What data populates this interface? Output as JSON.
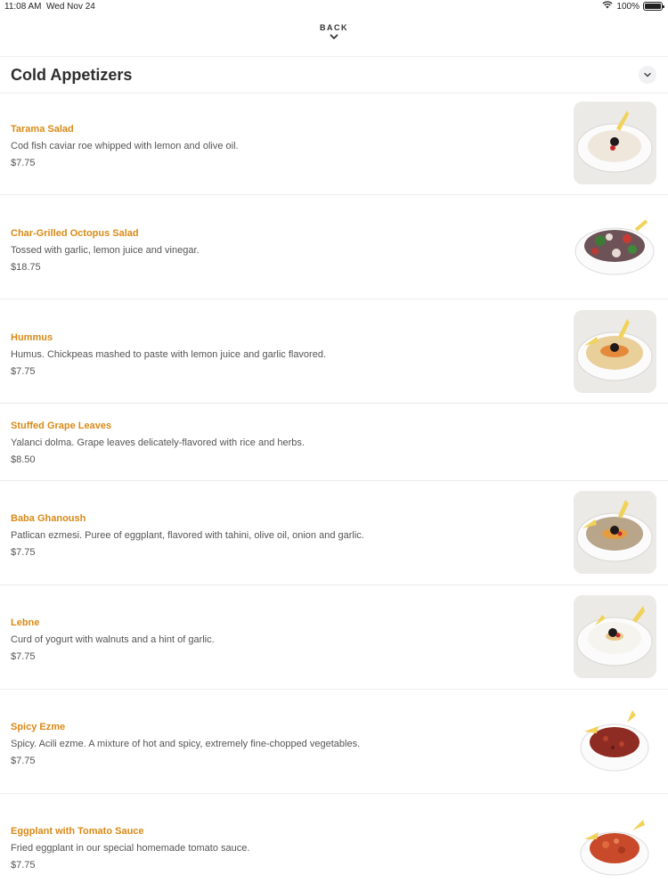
{
  "status_bar": {
    "time": "11:08 AM",
    "date": "Wed Nov 24",
    "battery": "100%",
    "battery_level": 1.0,
    "wifi_icon": "wifi-icon",
    "battery_icon": "battery-icon"
  },
  "nav": {
    "back_label": "BACK",
    "back_icon": "chevron-down-icon"
  },
  "section": {
    "title": "Cold Appetizers",
    "collapse_icon": "chevron-up-icon"
  },
  "colors": {
    "accent": "#d98a17",
    "text": "#555555",
    "divider": "#ececec"
  },
  "items": [
    {
      "name": "Tarama Salad",
      "description": "Cod fish caviar roe whipped with lemon and olive oil.",
      "price": "$7.75",
      "image": "tarama-salad-photo"
    },
    {
      "name": "Char-Grilled Octopus Salad",
      "description": "Tossed with garlic, lemon juice and vinegar.",
      "price": "$18.75",
      "image": "octopus-salad-photo"
    },
    {
      "name": "Hummus",
      "description": "Humus. Chickpeas mashed to paste with lemon juice and garlic flavored.",
      "price": "$7.75",
      "image": "hummus-photo"
    },
    {
      "name": "Stuffed Grape Leaves",
      "description": "Yalanci dolma. Grape leaves delicately-flavored with rice and herbs.",
      "price": "$8.50"
    },
    {
      "name": "Baba Ghanoush",
      "description": "Patlican ezmesi. Puree of eggplant, flavored with tahini, olive oil, onion and garlic.",
      "price": "$7.75",
      "image": "baba-ghanoush-photo"
    },
    {
      "name": "Lebne",
      "description": "Curd of yogurt with walnuts and a hint of garlic.",
      "price": "$7.75",
      "image": "lebne-photo"
    },
    {
      "name": "Spicy Ezme",
      "description": "Spicy. Acili ezme. A mixture of hot and spicy, extremely fine-chopped vegetables.",
      "price": "$7.75",
      "image": "spicy-ezme-photo"
    },
    {
      "name": "Eggplant with Tomato Sauce",
      "description": "Fried eggplant in our special homemade tomato sauce.",
      "price": "$7.75",
      "image": "eggplant-tomato-photo"
    }
  ]
}
